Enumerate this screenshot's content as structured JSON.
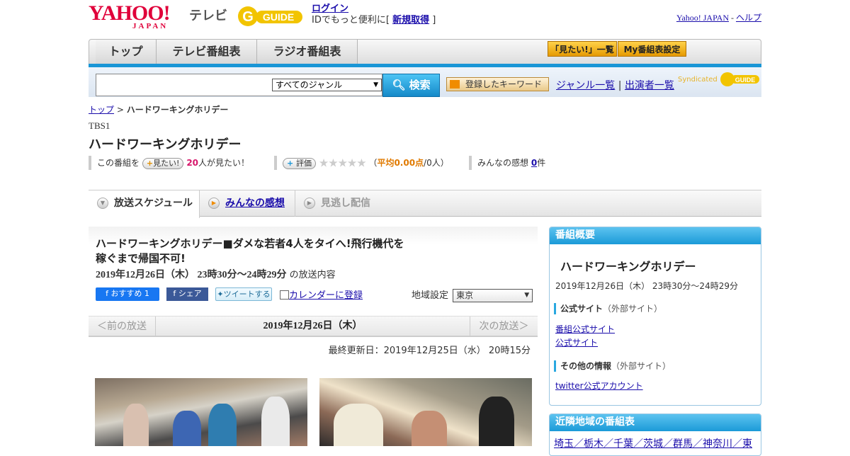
{
  "header": {
    "logo_yahoo": "YAHOO!",
    "logo_japan": "JAPAN",
    "logo_tv": "テレビ",
    "gguide_logo": "G GUIDE",
    "login_label": "ログイン",
    "login_note_prefix": "IDでもっと便利に[ ",
    "register_label": "新規取得",
    "login_note_suffix": " ]",
    "yahoo_japan_link": "Yahoo! JAPAN",
    "separator": " - ",
    "help_link": "ヘルプ"
  },
  "nav": {
    "tabs": [
      {
        "label": "トップ"
      },
      {
        "label": "テレビ番組表"
      },
      {
        "label": "ラジオ番組表"
      }
    ],
    "want_list_button": "「見たい!」一覧",
    "my_settings_button": "My番組表設定"
  },
  "search": {
    "query": "",
    "genre_selected": "すべてのジャンル",
    "search_button": "検索",
    "keyword_button": "登録したキーワード",
    "genre_list_link": "ジャンル一覧",
    "divider": "|",
    "performer_list_link": "出演者一覧",
    "syndicated": "Syndicated"
  },
  "breadcrumb": {
    "home": "トップ",
    "sep": " > ",
    "current": "ハードワーキングホリデー"
  },
  "program": {
    "station": "TBS1",
    "title": "ハードワーキングホリデー",
    "want_prefix": "この番組を",
    "want_button": "見たい!",
    "want_count": "20",
    "want_suffix": "人が見たい！",
    "rate_button": "評価",
    "stars": "★★★★★",
    "rating_open": "（",
    "rating_avg": "平均0.00点",
    "rating_rest": "/0人）",
    "impressions_label": "みんなの感想",
    "impressions_count": "0",
    "impressions_suffix": "件"
  },
  "tabs": {
    "schedule": "放送スケジュール",
    "impressions": "みんなの感想",
    "missed": "見逃し配信"
  },
  "episode": {
    "title": "ハードワーキングホリデー■ダメな若者4人をタイへ!飛行機代を稼ぐまで帰国不可!",
    "date_time": "2019年12月26日（木）  23時30分～24時29分",
    "date_suffix": "の放送内容",
    "fb_recommend": "おすすめ 1",
    "fb_share": "シェア",
    "tweet": "ツイートする",
    "calendar": "カレンダーに登録",
    "region_label": "地域設定",
    "region_value": "東京",
    "prev": "＜前の放送",
    "pager_date": "2019年12月26日（木）",
    "next": "次の放送＞",
    "updated": "最終更新日：2019年12月25日（水） 20時15分"
  },
  "sidebar": {
    "overview_head": "番組概要",
    "title": "ハードワーキングホリデー",
    "date": "2019年12月26日（木） 23時30分～24時29分",
    "official_label": "公式サイト",
    "external_note": "（外部サイト）",
    "official_links": [
      "番組公式サイト",
      "公式サイト"
    ],
    "other_label": "その他の情報",
    "twitter_link": "twitter公式アカウント",
    "nearby_head": "近隣地域の番組表",
    "nearby_links": "埼玉／栃木／千葉／茨城／群馬／神奈川／東"
  },
  "colors": {
    "accent": "#1a96d6",
    "brand_red": "#e0003a",
    "link": "#1a0dab",
    "want_count": "#d6166a",
    "rating": "#e07a00"
  }
}
